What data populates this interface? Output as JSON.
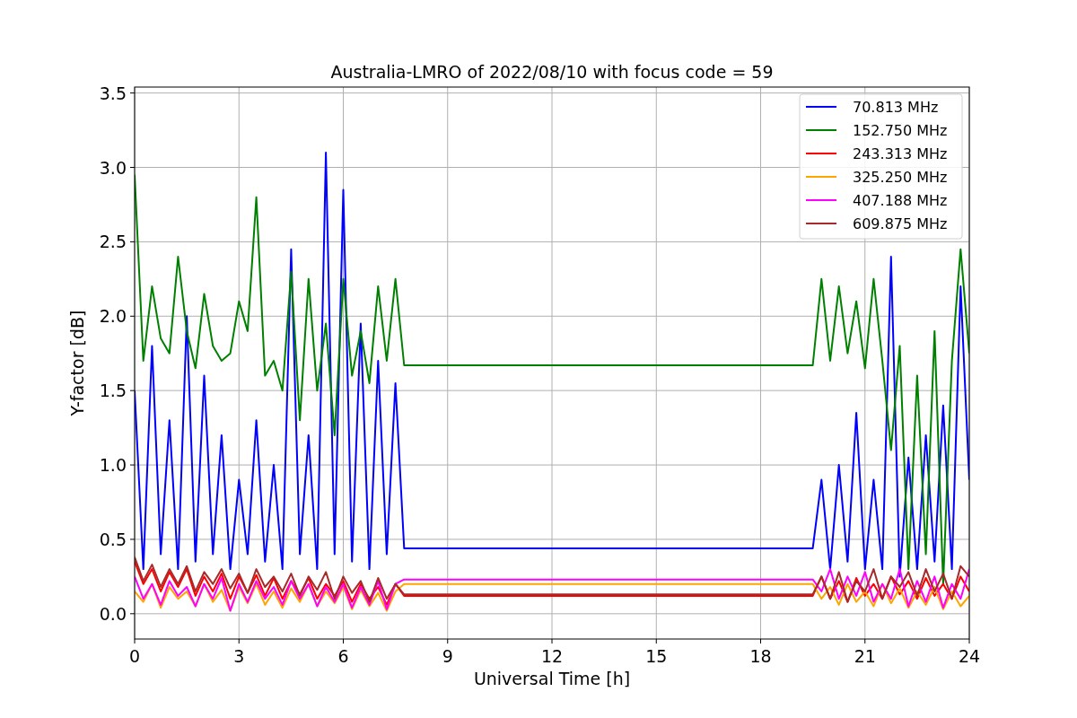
{
  "chart_data": {
    "type": "line",
    "title": "Australia-LMRO of 2022/08/10 with focus code = 59",
    "xlabel": "Universal Time [h]",
    "ylabel": "Y-factor [dB]",
    "x": [
      0,
      0.25,
      0.5,
      0.75,
      1,
      1.25,
      1.5,
      1.75,
      2,
      2.25,
      2.5,
      2.75,
      3,
      3.25,
      3.5,
      3.75,
      4,
      4.25,
      4.5,
      4.75,
      5,
      5.25,
      5.5,
      5.75,
      6,
      6.25,
      6.5,
      6.75,
      7,
      7.25,
      7.5,
      7.75,
      19.5,
      19.75,
      20,
      20.25,
      20.5,
      20.75,
      21,
      21.25,
      21.5,
      21.75,
      22,
      22.25,
      22.5,
      22.75,
      23,
      23.25,
      23.5,
      23.75,
      24
    ],
    "series": [
      {
        "name": "70.813 MHz",
        "color": "#0000ff",
        "values": [
          1.5,
          0.3,
          1.8,
          0.4,
          1.3,
          0.3,
          2.0,
          0.35,
          1.6,
          0.4,
          1.2,
          0.3,
          0.9,
          0.4,
          1.3,
          0.35,
          1.0,
          0.3,
          2.45,
          0.4,
          1.2,
          0.3,
          3.1,
          0.4,
          2.85,
          0.35,
          1.95,
          0.3,
          1.7,
          0.4,
          1.55,
          0.44,
          0.44,
          0.9,
          0.3,
          1.0,
          0.35,
          1.35,
          0.3,
          0.9,
          0.3,
          2.4,
          0.25,
          1.05,
          0.3,
          1.2,
          0.35,
          1.4,
          0.3,
          2.2,
          0.9
        ]
      },
      {
        "name": "152.750 MHz",
        "color": "#008000",
        "values": [
          2.95,
          1.7,
          2.2,
          1.85,
          1.75,
          2.4,
          1.9,
          1.65,
          2.15,
          1.8,
          1.7,
          1.75,
          2.1,
          1.9,
          2.8,
          1.6,
          1.7,
          1.5,
          2.3,
          1.3,
          2.25,
          1.5,
          1.95,
          1.2,
          2.25,
          1.6,
          1.9,
          1.55,
          2.2,
          1.7,
          2.25,
          1.67,
          1.67,
          2.25,
          1.7,
          2.2,
          1.75,
          2.1,
          1.65,
          2.25,
          1.7,
          1.1,
          1.8,
          0.3,
          1.6,
          0.4,
          1.9,
          0.2,
          1.7,
          2.45,
          1.75
        ]
      },
      {
        "name": "243.313 MHz",
        "color": "#ff0000",
        "values": [
          0.35,
          0.2,
          0.3,
          0.15,
          0.28,
          0.18,
          0.3,
          0.12,
          0.25,
          0.15,
          0.27,
          0.1,
          0.25,
          0.14,
          0.26,
          0.12,
          0.24,
          0.1,
          0.22,
          0.13,
          0.24,
          0.1,
          0.2,
          0.12,
          0.22,
          0.08,
          0.2,
          0.1,
          0.18,
          0.06,
          0.2,
          0.12,
          0.12,
          0.25,
          0.1,
          0.22,
          0.08,
          0.24,
          0.12,
          0.2,
          0.1,
          0.25,
          0.13,
          0.22,
          0.1,
          0.24,
          0.12,
          0.2,
          0.1,
          0.25,
          0.15
        ]
      },
      {
        "name": "325.250 MHz",
        "color": "#ffa500",
        "values": [
          0.15,
          0.08,
          0.2,
          0.04,
          0.18,
          0.1,
          0.15,
          0.05,
          0.2,
          0.08,
          0.16,
          0.02,
          0.18,
          0.07,
          0.2,
          0.06,
          0.15,
          0.04,
          0.17,
          0.08,
          0.2,
          0.05,
          0.15,
          0.07,
          0.18,
          0.03,
          0.16,
          0.05,
          0.14,
          0.02,
          0.15,
          0.2,
          0.2,
          0.1,
          0.18,
          0.06,
          0.2,
          0.08,
          0.15,
          0.05,
          0.2,
          0.07,
          0.17,
          0.04,
          0.15,
          0.06,
          0.18,
          0.03,
          0.15,
          0.05,
          0.12
        ]
      },
      {
        "name": "407.188 MHz",
        "color": "#ff00ff",
        "values": [
          0.25,
          0.1,
          0.2,
          0.06,
          0.22,
          0.12,
          0.18,
          0.05,
          0.2,
          0.1,
          0.24,
          0.02,
          0.2,
          0.08,
          0.22,
          0.1,
          0.18,
          0.06,
          0.22,
          0.1,
          0.2,
          0.05,
          0.18,
          0.08,
          0.2,
          0.04,
          0.18,
          0.06,
          0.22,
          0.03,
          0.2,
          0.23,
          0.23,
          0.15,
          0.3,
          0.1,
          0.25,
          0.12,
          0.28,
          0.08,
          0.2,
          0.1,
          0.3,
          0.05,
          0.22,
          0.08,
          0.25,
          0.04,
          0.2,
          0.1,
          0.3
        ]
      },
      {
        "name": "609.875 MHz",
        "color": "#a52a2a",
        "values": [
          0.38,
          0.22,
          0.33,
          0.18,
          0.3,
          0.2,
          0.32,
          0.15,
          0.28,
          0.2,
          0.3,
          0.17,
          0.27,
          0.14,
          0.3,
          0.18,
          0.25,
          0.15,
          0.27,
          0.12,
          0.25,
          0.16,
          0.28,
          0.1,
          0.25,
          0.14,
          0.22,
          0.08,
          0.24,
          0.1,
          0.2,
          0.13,
          0.13,
          0.25,
          0.1,
          0.28,
          0.08,
          0.22,
          0.15,
          0.3,
          0.1,
          0.25,
          0.18,
          0.28,
          0.12,
          0.3,
          0.15,
          0.27,
          0.1,
          0.32,
          0.25
        ]
      }
    ],
    "grid": true,
    "legend": true,
    "xlim": [
      0,
      24
    ],
    "ylim": [
      -0.17,
      3.54
    ],
    "xticks": [
      0,
      3,
      6,
      9,
      12,
      15,
      18,
      21,
      24
    ],
    "yticks": [
      {
        "value": 0,
        "label": "0.0"
      },
      {
        "value": 0.5,
        "label": "0.5"
      },
      {
        "value": 1,
        "label": "1.0"
      },
      {
        "value": 1.5,
        "label": "1.5"
      },
      {
        "value": 2,
        "label": "2.0"
      },
      {
        "value": 2.5,
        "label": "2.5"
      },
      {
        "value": 3,
        "label": "3.0"
      },
      {
        "value": 3.5,
        "label": "3.5"
      }
    ]
  }
}
